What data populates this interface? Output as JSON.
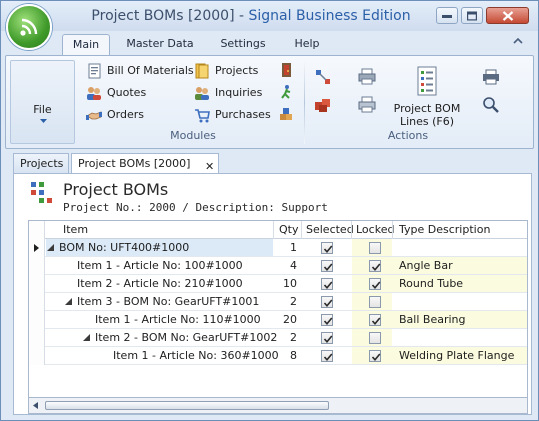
{
  "window": {
    "title_main": "Project BOMs [2000] - ",
    "title_edition": "Signal Business Edition"
  },
  "ribbon": {
    "tabs": [
      "Main",
      "Master Data",
      "Settings",
      "Help"
    ],
    "active_tab": "Main",
    "file_label": "File",
    "modules": {
      "group_label": "Modules",
      "items": [
        "Bill Of Materials",
        "Quotes",
        "Orders",
        "Projects",
        "Inquiries",
        "Purchases"
      ]
    },
    "actions": {
      "group_label": "Actions",
      "big_button_label": "Project BOM\nLines (F6)"
    }
  },
  "doc_tabs": [
    {
      "label": "Projects",
      "active": false
    },
    {
      "label": "Project BOMs [2000]",
      "active": true,
      "close": "✕"
    }
  ],
  "page": {
    "title": "Project BOMs",
    "subtitle": "Project No.: 2000 / Description: Support"
  },
  "grid": {
    "columns": [
      "Item",
      "Qty",
      "Selected",
      "Locked",
      "Type Description"
    ],
    "rows": [
      {
        "item": "BOM No: UFT400#1000",
        "qty": "1",
        "selected": true,
        "locked": false,
        "type": "",
        "level": 0,
        "expandable": true,
        "current": true
      },
      {
        "item": "Item 1 - Article No: 100#1000",
        "qty": "4",
        "selected": true,
        "locked": true,
        "type": "Angle Bar",
        "level": 1,
        "expandable": false,
        "current": false
      },
      {
        "item": "Item 2 - Article No: 210#1000",
        "qty": "10",
        "selected": true,
        "locked": true,
        "type": "Round Tube",
        "level": 1,
        "expandable": false,
        "current": false
      },
      {
        "item": "Item 3 - BOM No: GearUFT#1001",
        "qty": "2",
        "selected": true,
        "locked": false,
        "type": "",
        "level": 1,
        "expandable": true,
        "current": false
      },
      {
        "item": "Item 1 - Article No: 110#1000",
        "qty": "20",
        "selected": true,
        "locked": true,
        "type": "Ball Bearing",
        "level": 2,
        "expandable": false,
        "current": false
      },
      {
        "item": "Item 2 - BOM No: GearUFT#1002",
        "qty": "2",
        "selected": true,
        "locked": false,
        "type": "",
        "level": 2,
        "expandable": true,
        "current": false
      },
      {
        "item": "Item 1 - Article No: 360#1000",
        "qty": "8",
        "selected": true,
        "locked": true,
        "type": "Welding Plate Flange",
        "level": 3,
        "expandable": false,
        "current": false
      }
    ]
  }
}
